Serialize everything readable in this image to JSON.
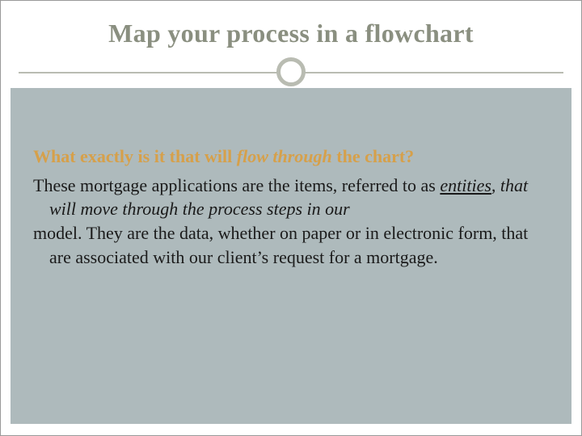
{
  "title": "Map your process in a flowchart",
  "question_lead": "What exactly is it that will ",
  "question_italic": "flow through",
  "question_tail": " the chart?",
  "body_p1_a": "These mortgage applications are the items, referred to as ",
  "body_p1_entities": "entities",
  "body_p1_b": ", that will move through the process steps in our",
  "body_p2": "model. They are the data, whether on paper or in electronic form, that are associated with our client’s request for a mortgage."
}
